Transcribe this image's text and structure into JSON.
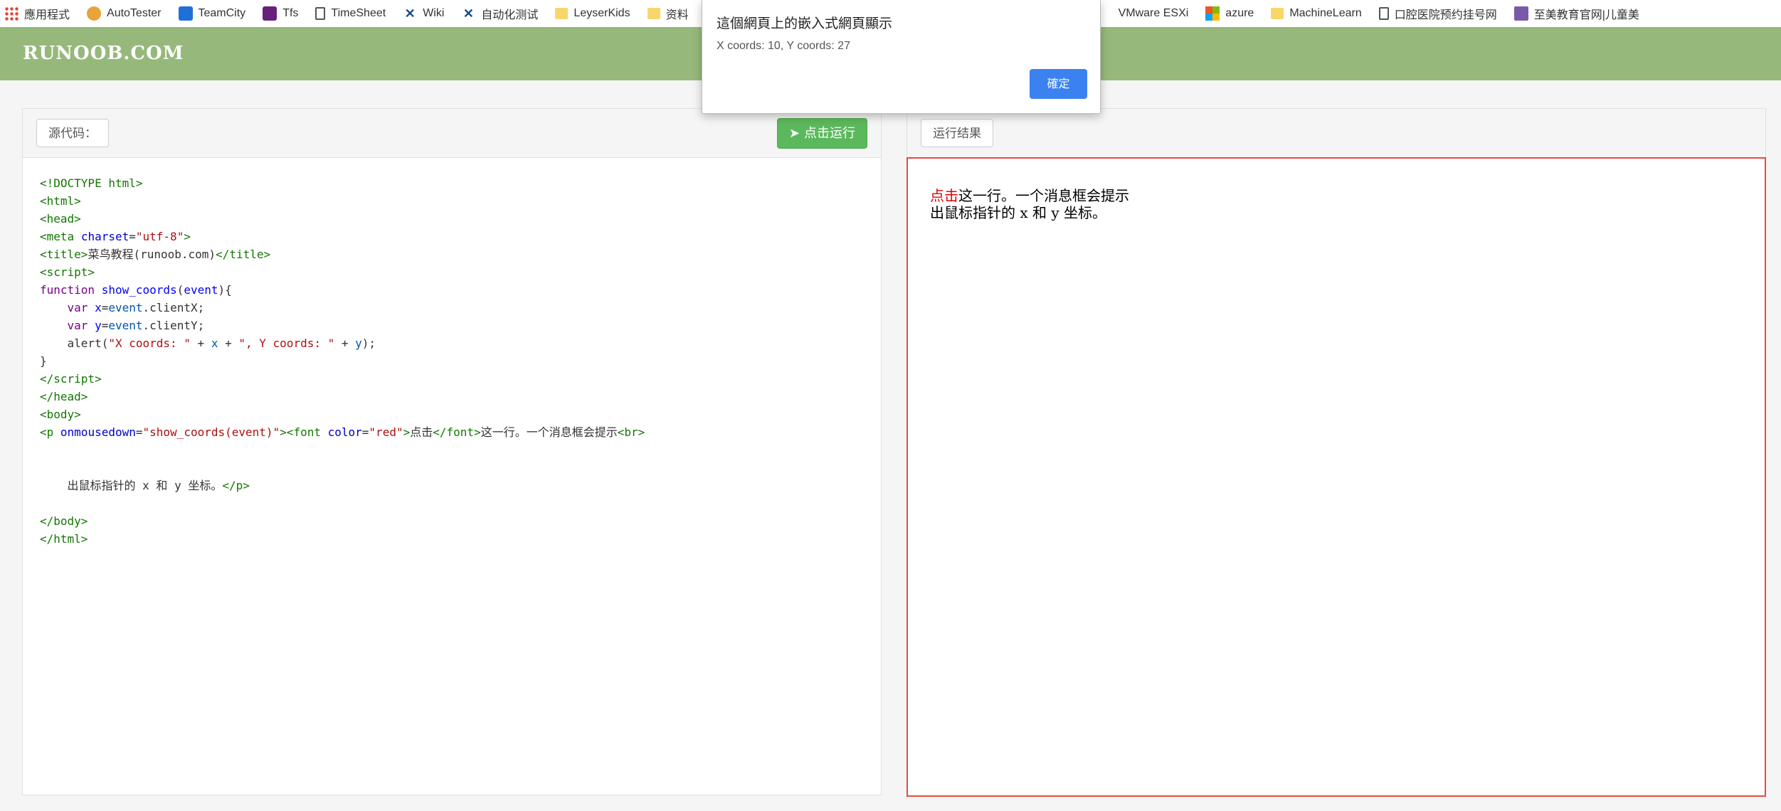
{
  "bookmarks": [
    {
      "label": "應用程式",
      "icon": "apps-icon"
    },
    {
      "label": "AutoTester",
      "icon": "autotester-icon"
    },
    {
      "label": "TeamCity",
      "icon": "teamcity-icon"
    },
    {
      "label": "Tfs",
      "icon": "visual-studio-icon"
    },
    {
      "label": "TimeSheet",
      "icon": "page-icon"
    },
    {
      "label": "Wiki",
      "icon": "x-icon"
    },
    {
      "label": "自动化测试",
      "icon": "x-icon"
    },
    {
      "label": "LeyserKids",
      "icon": "folder-icon"
    },
    {
      "label": "资料",
      "icon": "folder-icon"
    },
    {
      "label": "VMware ESXi",
      "icon": ""
    },
    {
      "label": "azure",
      "icon": "microsoft-icon"
    },
    {
      "label": "MachineLearn",
      "icon": "folder-icon"
    },
    {
      "label": "口腔医院预约挂号网",
      "icon": "page-icon"
    },
    {
      "label": "至美教育官网|儿童美",
      "icon": "book-icon"
    }
  ],
  "header": {
    "logo": "RUNOOB.COM"
  },
  "editor": {
    "source_label": "源代码：",
    "run_label": "点击运行"
  },
  "result": {
    "label": "运行结果",
    "red_text": "点击",
    "line1_rest": "这一行。一个消息框会提示",
    "line2": "出鼠标指针的 x 和 y 坐标。"
  },
  "dialog": {
    "title": "這個網頁上的嵌入式網頁顯示",
    "message": "X coords: 10, Y coords: 27",
    "ok_label": "確定"
  }
}
